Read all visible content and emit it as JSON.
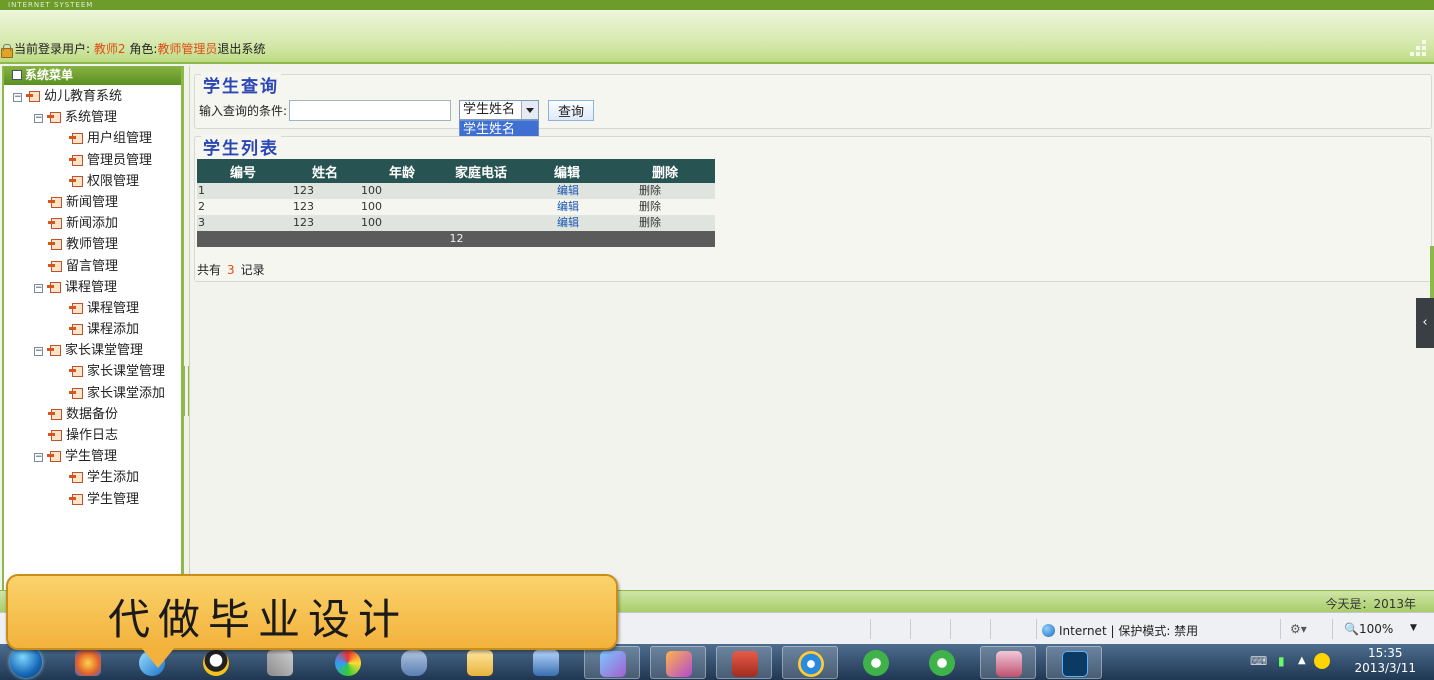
{
  "header": {
    "brand": "INTERNET SYSTEEM",
    "login_label": "当前登录用户:",
    "user": "教师2",
    "role_label": "角色:",
    "role": "教师管理员",
    "logout": "退出系统"
  },
  "sidebar": {
    "title": "系统菜单",
    "root": "幼儿教育系统",
    "items": [
      {
        "label": "系统管理",
        "level": 1,
        "toggle": "⊟"
      },
      {
        "label": "用户组管理",
        "level": 2
      },
      {
        "label": "管理员管理",
        "level": 2
      },
      {
        "label": "权限管理",
        "level": 2
      },
      {
        "label": "新闻管理",
        "level": 1
      },
      {
        "label": "新闻添加",
        "level": 1
      },
      {
        "label": "教师管理",
        "level": 1
      },
      {
        "label": "留言管理",
        "level": 1
      },
      {
        "label": "课程管理",
        "level": 1,
        "toggle": "⊟"
      },
      {
        "label": "课程管理",
        "level": 2
      },
      {
        "label": "课程添加",
        "level": 2
      },
      {
        "label": "家长课堂管理",
        "level": 1,
        "toggle": "⊟"
      },
      {
        "label": "家长课堂管理",
        "level": 2
      },
      {
        "label": "家长课堂添加",
        "level": 2
      },
      {
        "label": "数据备份",
        "level": 1
      },
      {
        "label": "操作日志",
        "level": 1
      },
      {
        "label": "学生管理",
        "level": 1,
        "toggle": "⊟"
      },
      {
        "label": "学生添加",
        "level": 2
      },
      {
        "label": "学生管理",
        "level": 2
      }
    ]
  },
  "search": {
    "title": "学生查询",
    "label": "输入查询的条件:",
    "value": "",
    "select_value": "学生姓名",
    "select_open_option": "学生姓名",
    "button": "查询"
  },
  "list": {
    "title": "学生列表",
    "columns": [
      "编号",
      "姓名",
      "年龄",
      "家庭电话",
      "编辑",
      "删除"
    ],
    "rows": [
      [
        "1",
        "123",
        "100",
        "",
        "编辑",
        "删除"
      ],
      [
        "2",
        "123",
        "100",
        "",
        "编辑",
        "删除"
      ],
      [
        "3",
        "123",
        "100",
        "",
        "编辑",
        "删除"
      ]
    ],
    "pager": "12",
    "total_prefix": "共有",
    "total_count": "3",
    "total_suffix": "记录"
  },
  "footer": {
    "today": "今天是：2013年"
  },
  "ie_status": {
    "zone": "Internet | 保护模式: 禁用",
    "zoom": "100%"
  },
  "taskbar": {
    "time": "15:35",
    "date": "2013/3/11"
  },
  "banner": {
    "text": "代做毕业设计"
  },
  "colors": {
    "accent_green": "#8db84a",
    "table_header": "#275452",
    "title_blue": "#2b47b4",
    "highlight_red": "#e04b12"
  }
}
